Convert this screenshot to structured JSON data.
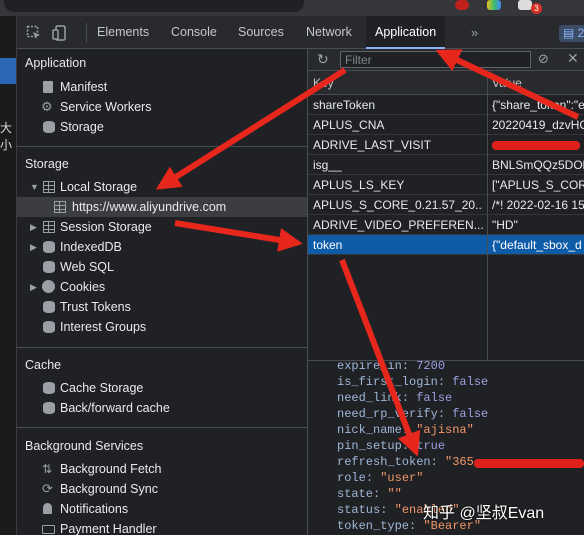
{
  "browser": {
    "extension_badge": "3"
  },
  "page_strip": {
    "text": "大小"
  },
  "toolbar": {
    "tabs": [
      {
        "label": "Elements"
      },
      {
        "label": "Console"
      },
      {
        "label": "Sources"
      },
      {
        "label": "Network"
      },
      {
        "label": "Application",
        "active": true
      }
    ],
    "more": "»",
    "issues_count": "2"
  },
  "sidebar": {
    "application": {
      "title": "Application",
      "items": [
        {
          "label": "Manifest",
          "icon": "document-icon"
        },
        {
          "label": "Service Workers",
          "icon": "gear-icon"
        },
        {
          "label": "Storage",
          "icon": "database-icon"
        }
      ]
    },
    "storage": {
      "title": "Storage",
      "items": [
        {
          "label": "Local Storage",
          "icon": "grid-icon",
          "expanded": true
        },
        {
          "label": "https://www.aliyundrive.com",
          "icon": "grid-icon",
          "selected": true
        },
        {
          "label": "Session Storage",
          "icon": "grid-icon"
        },
        {
          "label": "IndexedDB",
          "icon": "database-icon"
        },
        {
          "label": "Web SQL",
          "icon": "database-icon"
        },
        {
          "label": "Cookies",
          "icon": "cookie-icon"
        },
        {
          "label": "Trust Tokens",
          "icon": "database-icon"
        },
        {
          "label": "Interest Groups",
          "icon": "database-icon"
        }
      ]
    },
    "cache": {
      "title": "Cache",
      "items": [
        {
          "label": "Cache Storage",
          "icon": "database-icon"
        },
        {
          "label": "Back/forward cache",
          "icon": "database-icon"
        }
      ]
    },
    "background": {
      "title": "Background Services",
      "items": [
        {
          "label": "Background Fetch",
          "icon": "arrows-updown-icon"
        },
        {
          "label": "Background Sync",
          "icon": "sync-icon"
        },
        {
          "label": "Notifications",
          "icon": "bell-icon"
        },
        {
          "label": "Payment Handler",
          "icon": "card-icon"
        }
      ]
    }
  },
  "main": {
    "filter_placeholder": "Filter",
    "headers": {
      "key": "Key",
      "value": "Value"
    },
    "rows": [
      {
        "key": "shareToken",
        "value": "{\"share_token\":\"e"
      },
      {
        "key": "APLUS_CNA",
        "value": "20220419_dzvHG"
      },
      {
        "key": "ADRIVE_LAST_VISIT",
        "value": ""
      },
      {
        "key": "isg__",
        "value": "BNLSmQQz5DOl"
      },
      {
        "key": "APLUS_LS_KEY",
        "value": "[\"APLUS_S_CORE"
      },
      {
        "key": "APLUS_S_CORE_0.21.57_20...",
        "value": "/*! 2022-02-16 15"
      },
      {
        "key": "ADRIVE_VIDEO_PREFEREN...",
        "value": "\"HD\""
      },
      {
        "key": "token",
        "value": "{\"default_sbox_d",
        "selected": true
      }
    ],
    "preview": [
      {
        "key": "expire_in",
        "sep": ": ",
        "value": "7200",
        "kind": "num"
      },
      {
        "key": "is_first_login",
        "sep": ": ",
        "value": "false",
        "kind": "bool"
      },
      {
        "key": "need_link",
        "sep": ": ",
        "value": "false",
        "kind": "bool"
      },
      {
        "key": "need_rp_verify",
        "sep": ": ",
        "value": "false",
        "kind": "bool"
      },
      {
        "key": "nick_name",
        "sep": ": ",
        "value": "\"ajisna\"",
        "kind": "str"
      },
      {
        "key": "pin_setup",
        "sep": ": ",
        "value": "true",
        "kind": "bool"
      },
      {
        "key": "refresh_token",
        "sep": ": ",
        "value": "\"365",
        "kind": "str"
      },
      {
        "key": "role",
        "sep": ": ",
        "value": "\"user\"",
        "kind": "str"
      },
      {
        "key": "state",
        "sep": ": ",
        "value": "\"\"",
        "kind": "str"
      },
      {
        "key": "status",
        "sep": ": ",
        "value": "\"enabled\"",
        "kind": "str"
      },
      {
        "key": "token_type",
        "sep": ": ",
        "value": "\"Bearer\"",
        "kind": "str"
      }
    ]
  },
  "watermark": "知乎 @坚叔Evan",
  "colors": {
    "annotation_arrow": "#e8271c",
    "selection": "#0e5ba8",
    "accent": "#8ab4f8"
  }
}
